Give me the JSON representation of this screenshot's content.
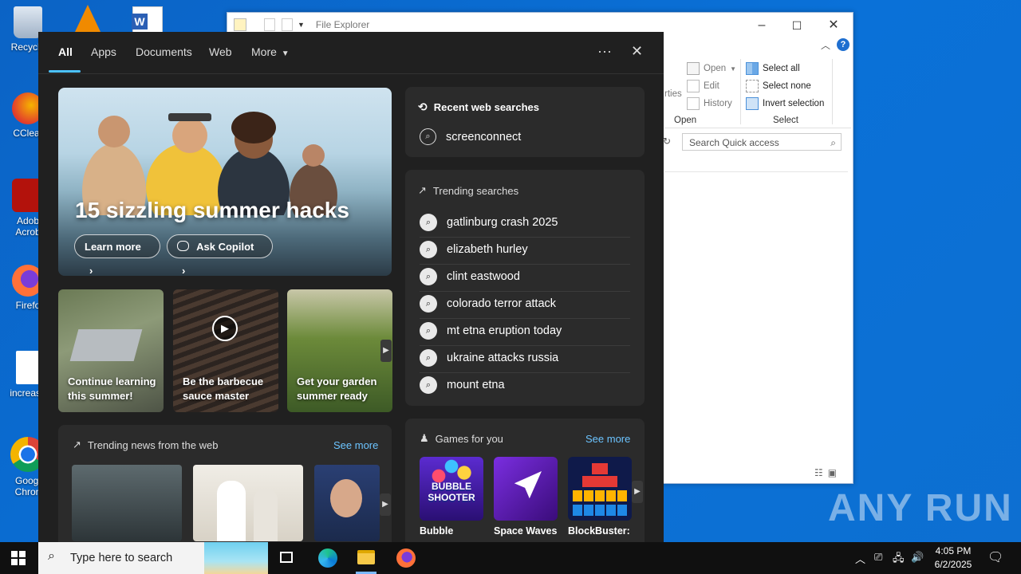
{
  "desktop": {
    "icons": [
      {
        "label": "Recycle"
      },
      {
        "label": "CClear"
      },
      {
        "label": "Adob\nAcrob"
      },
      {
        "label": "Firefo"
      },
      {
        "label": "increase"
      },
      {
        "label": "Googl\nChron"
      }
    ],
    "watermark": "ANY RUN"
  },
  "explorer": {
    "title": "File Explorer",
    "ribbon": {
      "open": "Open",
      "edit": "Edit",
      "history": "History",
      "open_group": "Open",
      "select_all": "Select all",
      "select_none": "Select none",
      "invert_selection": "Invert selection",
      "select_group": "Select",
      "properties_partial": "rties"
    },
    "search_placeholder": "Search Quick access"
  },
  "search_panel": {
    "tabs": [
      "All",
      "Apps",
      "Documents",
      "Web",
      "More"
    ],
    "active_tab": "All",
    "more_options": "···",
    "close": "✕",
    "hero": {
      "title": "15 sizzling summer hacks",
      "learn_more": "Learn more",
      "ask_copilot": "Ask Copilot"
    },
    "cards": [
      {
        "caption": "Continue learning this summer!"
      },
      {
        "caption": "Be the barbecue sauce master"
      },
      {
        "caption": "Get your garden summer ready"
      }
    ],
    "news": {
      "title": "Trending news from the web",
      "see_more": "See more"
    },
    "recent": {
      "title": "Recent web searches",
      "items": [
        "screenconnect"
      ]
    },
    "trending": {
      "title": "Trending searches",
      "items": [
        "gatlinburg crash 2025",
        "elizabeth hurley",
        "clint eastwood",
        "colorado terror attack",
        "mt etna eruption today",
        "ukraine attacks russia",
        "mount etna"
      ]
    },
    "games": {
      "title": "Games for you",
      "see_more": "See more",
      "items": [
        {
          "label": "Bubble",
          "art_text": "BUBBLE SHOOTER"
        },
        {
          "label": "Space Waves",
          "art_text": ""
        },
        {
          "label": "BlockBuster:",
          "art_text": ""
        }
      ]
    }
  },
  "taskbar": {
    "search_placeholder": "Type here to search",
    "time": "4:05 PM",
    "date": "6/2/2025"
  }
}
